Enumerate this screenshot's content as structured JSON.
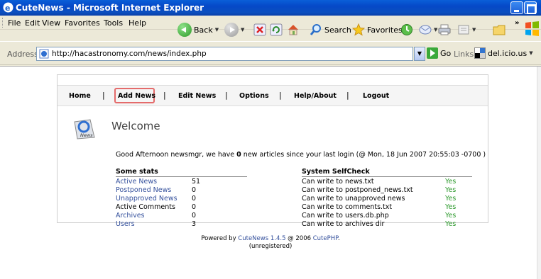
{
  "window": {
    "title": "CuteNews - Microsoft Internet Explorer"
  },
  "menu": {
    "items": [
      "File",
      "Edit",
      "View",
      "Favorites",
      "Tools",
      "Help"
    ]
  },
  "toolbar": {
    "back_label": "Back",
    "search_label": "Search",
    "favorites_label": "Favorites"
  },
  "address": {
    "label": "Address",
    "url": "http://hacastronomy.com/news/index.php",
    "go_label": "Go",
    "links_label": "Links",
    "bookmark_label": "del.icio.us"
  },
  "nav": {
    "items": [
      "Home",
      "Add News",
      "Edit News",
      "Options",
      "Help/About",
      "Logout"
    ],
    "separator": "|"
  },
  "icon_label": "News",
  "welcome": "Welcome",
  "greeting": {
    "prefix": "Good Afternoon newsmgr, we have ",
    "count": "0",
    "suffix": " new articles since your last login (@ Mon, 18 Jun 2007 20:55:03 -0700 )"
  },
  "stats": {
    "title": "Some stats",
    "rows": [
      {
        "label": "Active News",
        "value": "51"
      },
      {
        "label": "Postponed News",
        "value": "0"
      },
      {
        "label": "Unapproved News",
        "value": "0"
      },
      {
        "label": "Active Comments",
        "value": "0"
      },
      {
        "label": "Archives",
        "value": "0"
      },
      {
        "label": "Users",
        "value": "3"
      }
    ]
  },
  "selfcheck": {
    "title": "System SelfCheck",
    "rows": [
      {
        "label": "Can write to news.txt",
        "value": "Yes"
      },
      {
        "label": "Can write to postponed_news.txt",
        "value": "Yes"
      },
      {
        "label": "Can write to unapproved news",
        "value": "Yes"
      },
      {
        "label": "Can write to comments.txt",
        "value": "Yes"
      },
      {
        "label": "Can write to users.db.php",
        "value": "Yes"
      },
      {
        "label": "Can write to archives dir",
        "value": "Yes"
      }
    ]
  },
  "footer": {
    "powered_by": "Powered by ",
    "product": "CuteNews 1.4.5",
    "copyright": " @ 2006 ",
    "company": "CutePHP",
    "end": ".",
    "line2": "(unregistered)"
  },
  "colors": {
    "link": "#34509c",
    "yes": "#2e9a2e",
    "titlebar": "#0a5fd8"
  }
}
